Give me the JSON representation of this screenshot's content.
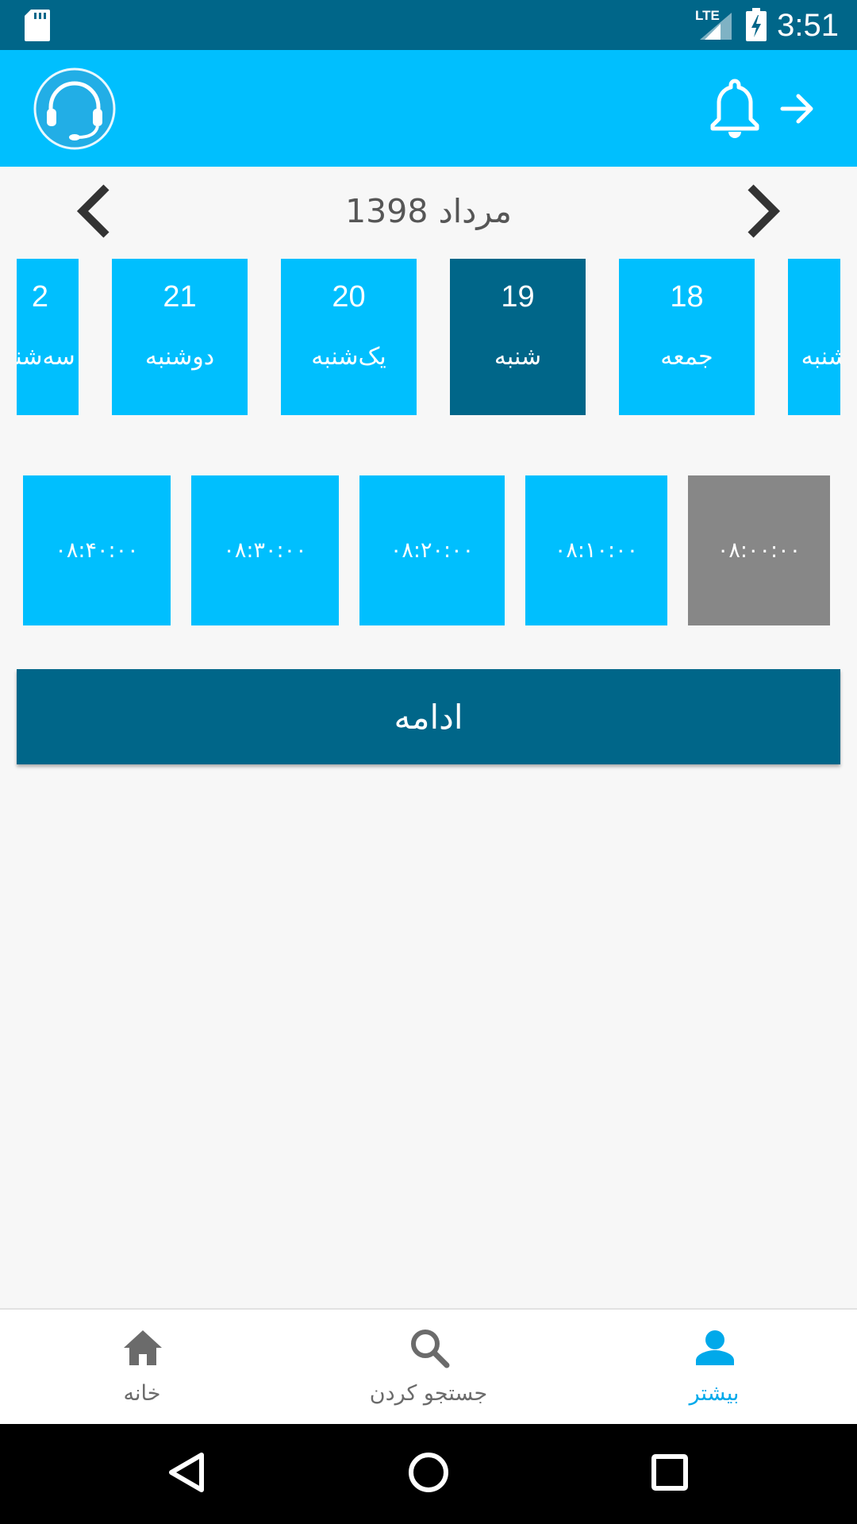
{
  "status_bar": {
    "time": "3:51",
    "network": "LTE",
    "icons": [
      "sd-card-icon",
      "signal-icon",
      "battery-charging-icon"
    ]
  },
  "app_bar": {
    "support_icon": "headset-icon",
    "notification_icon": "bell-icon",
    "forward_icon": "arrow-right-icon"
  },
  "calendar": {
    "month_title": "1398 مرداد",
    "days": [
      {
        "num": "2",
        "name": "سه‌شنبه",
        "selected": false
      },
      {
        "num": "21",
        "name": "دوشنبه",
        "selected": false
      },
      {
        "num": "20",
        "name": "یک‌شنبه",
        "selected": false
      },
      {
        "num": "19",
        "name": "شنبه",
        "selected": true
      },
      {
        "num": "18",
        "name": "جمعه",
        "selected": false
      },
      {
        "num": "",
        "name": "پنجشنبه",
        "selected": false
      }
    ]
  },
  "time_slots": [
    {
      "label": "۰۸:۴۰:۰۰",
      "available": true
    },
    {
      "label": "۰۸:۳۰:۰۰",
      "available": true
    },
    {
      "label": "۰۸:۲۰:۰۰",
      "available": true
    },
    {
      "label": "۰۸:۱۰:۰۰",
      "available": true
    },
    {
      "label": "۰۸:۰۰:۰۰",
      "available": false
    }
  ],
  "continue_label": "ادامه",
  "bottom_nav": [
    {
      "label": "خانه",
      "icon": "home-icon",
      "active": false
    },
    {
      "label": "جستجو کردن",
      "icon": "search-icon",
      "active": false
    },
    {
      "label": "بیشتر",
      "icon": "person-icon",
      "active": true
    }
  ],
  "colors": {
    "primary": "#00bffe",
    "primary_dark": "#006689",
    "disabled": "#878787",
    "background": "#f7f7f7",
    "nav_active": "#00a9ea"
  }
}
